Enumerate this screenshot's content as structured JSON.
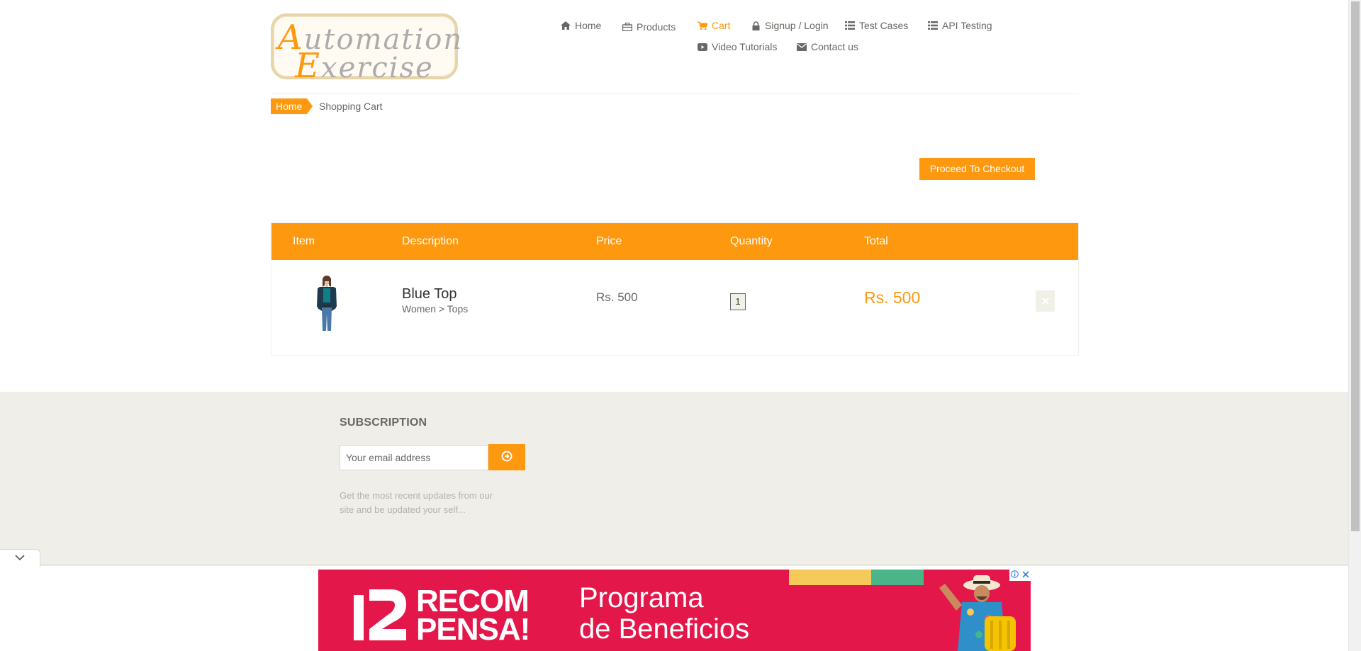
{
  "logo": {
    "line1_cap": "A",
    "line1_rest": "utomation",
    "line2_cap": "E",
    "line2_rest": "xercise"
  },
  "nav": {
    "home": "Home",
    "products": "Products",
    "cart": "Cart",
    "signup": "Signup / Login",
    "test_cases": "Test Cases",
    "api_testing": "API Testing",
    "video_tutorials": "Video Tutorials",
    "contact": "Contact us"
  },
  "breadcrumb": {
    "home": "Home",
    "current": "Shopping Cart"
  },
  "checkout_button": "Proceed To Checkout",
  "cart_table": {
    "headers": [
      "Item",
      "Description",
      "Price",
      "Quantity",
      "Total"
    ],
    "rows": [
      {
        "name": "Blue Top",
        "category": "Women > Tops",
        "price": "Rs. 500",
        "quantity": "1",
        "total": "Rs. 500",
        "delete_icon": "close-icon"
      }
    ]
  },
  "subscription": {
    "title": "SUBSCRIPTION",
    "placeholder": "Your email address",
    "note": "Get the most recent updates from our site and be updated your self..."
  },
  "ad": {
    "brand_line1": "RECOM",
    "brand_line2": "PENSA!",
    "headline1": "Programa",
    "headline2": "de Beneficios"
  },
  "colors": {
    "accent": "#fe980f",
    "footer_bg": "#efeee8",
    "ad_bg": "#e4174a"
  }
}
